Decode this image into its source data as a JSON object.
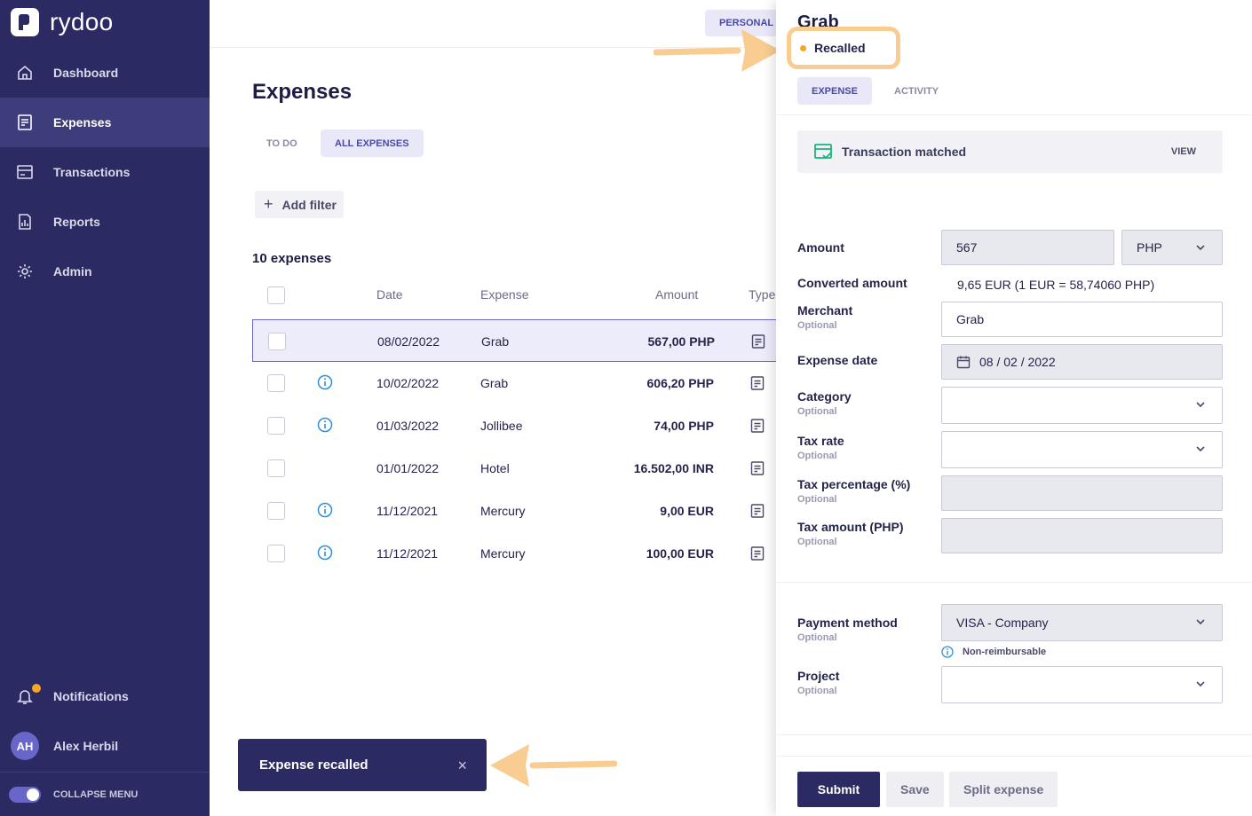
{
  "app": {
    "logo_text": "rydoo"
  },
  "sidebar": {
    "items": [
      {
        "label": "Dashboard",
        "icon": "home-icon"
      },
      {
        "label": "Expenses",
        "icon": "receipt-icon",
        "active": true
      },
      {
        "label": "Transactions",
        "icon": "card-icon"
      },
      {
        "label": "Reports",
        "icon": "report-icon"
      },
      {
        "label": "Admin",
        "icon": "gear-icon"
      }
    ],
    "notifications_label": "Notifications",
    "user": {
      "initials": "AH",
      "name": "Alex Herbil"
    },
    "collapse_label": "COLLAPSE MENU"
  },
  "topbar": {
    "personal_label": "PERSONAL"
  },
  "main": {
    "title": "Expenses",
    "tabs": [
      "TO DO",
      "ALL EXPENSES"
    ],
    "add_filter_label": "Add filter",
    "count_label": "10 expenses",
    "columns": {
      "date": "Date",
      "expense": "Expense",
      "amount": "Amount",
      "type": "Type"
    },
    "rows": [
      {
        "date": "08/02/2022",
        "expense": "Grab",
        "amount": "567,00 PHP",
        "info": false,
        "selected": true
      },
      {
        "date": "10/02/2022",
        "expense": "Grab",
        "amount": "606,20 PHP",
        "info": true
      },
      {
        "date": "01/03/2022",
        "expense": "Jollibee",
        "amount": "74,00 PHP",
        "info": true
      },
      {
        "date": "01/01/2022",
        "expense": "Hotel",
        "amount": "16.502,00 INR",
        "info": false
      },
      {
        "date": "11/12/2021",
        "expense": "Mercury",
        "amount": "9,00 EUR",
        "info": true
      },
      {
        "date": "11/12/2021",
        "expense": "Mercury",
        "amount": "100,00 EUR",
        "info": true
      }
    ]
  },
  "toast": {
    "message": "Expense recalled",
    "close": "×"
  },
  "panel": {
    "title": "Grab",
    "status": "Recalled",
    "tabs": [
      "EXPENSE",
      "ACTIVITY"
    ],
    "matched": {
      "label": "Transaction matched",
      "action": "VIEW"
    },
    "optional_label": "Optional",
    "fields": {
      "amount_label": "Amount",
      "amount_value": "567",
      "currency_value": "PHP",
      "converted_label": "Converted amount",
      "converted_value": "9,65 EUR (1 EUR = 58,74060 PHP)",
      "merchant_label": "Merchant",
      "merchant_value": "Grab",
      "date_label": "Expense date",
      "date_value": "08 / 02 / 2022",
      "category_label": "Category",
      "taxrate_label": "Tax rate",
      "taxpct_label": "Tax percentage (%)",
      "taxamt_label": "Tax amount (PHP)",
      "payment_label": "Payment method",
      "payment_value": "VISA - Company",
      "nonreimb_label": "Non-reimbursable",
      "project_label": "Project"
    },
    "buttons": {
      "submit": "Submit",
      "save": "Save",
      "split": "Split expense"
    }
  },
  "colors": {
    "sidebar": "#2b2a63",
    "accent": "#6866c9",
    "highlight": "#f9cc92",
    "status_dot": "#f5a623"
  }
}
